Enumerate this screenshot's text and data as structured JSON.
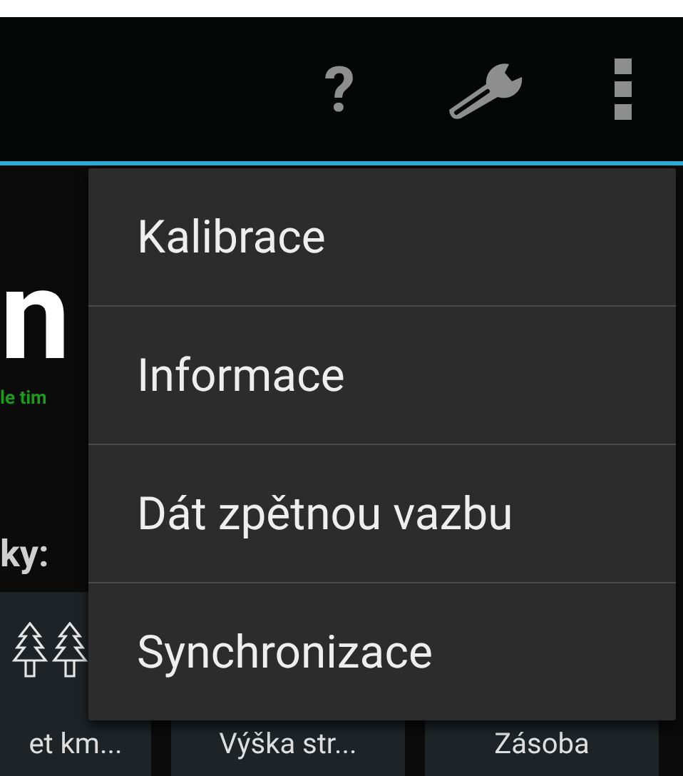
{
  "toolbar": {
    "help_label": "?"
  },
  "background": {
    "logo_text": "n",
    "tagline": "le tim",
    "section_label": "ky:",
    "tiles": [
      {
        "kind": "trees",
        "label": "et km..."
      },
      {
        "kind": "plain",
        "label": "Výška str..."
      },
      {
        "kind": "plain",
        "label": "Zásoba"
      }
    ]
  },
  "menu": {
    "items": [
      "Kalibrace",
      "Informace",
      "Dát zpětnou vazbu",
      "Synchronizace"
    ]
  }
}
